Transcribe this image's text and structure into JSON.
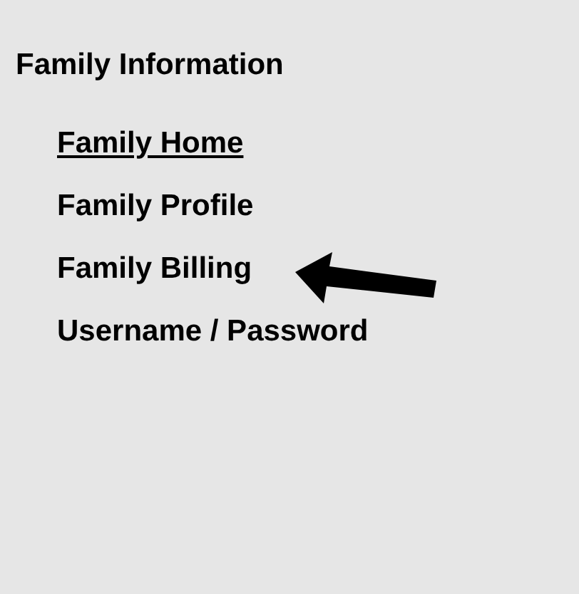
{
  "heading": "Family Information",
  "links": [
    {
      "label": "Family Home",
      "selected": true
    },
    {
      "label": "Family Profile",
      "selected": false
    },
    {
      "label": "Family Billing",
      "selected": false
    },
    {
      "label": "Username / Password",
      "selected": false
    }
  ]
}
